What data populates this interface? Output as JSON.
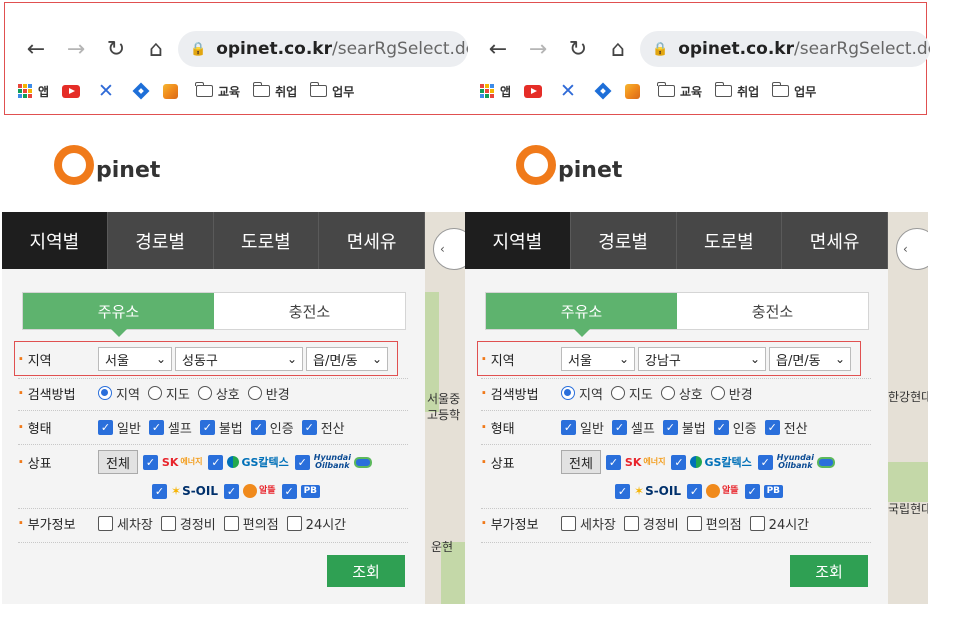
{
  "browser": {
    "url_host": "opinet.co.kr",
    "url_path": "/searRgSelect.do",
    "bookmarks": [
      {
        "label": "앱",
        "icon": "apps-grid-icon"
      },
      {
        "label": "",
        "icon": "youtube-icon"
      },
      {
        "label": "",
        "icon": "x-logo-icon"
      },
      {
        "label": "",
        "icon": "diamond-icon"
      },
      {
        "label": "",
        "icon": "cube-icon"
      },
      {
        "label": "교육",
        "icon": "folder-icon"
      },
      {
        "label": "취업",
        "icon": "folder-icon"
      },
      {
        "label": "업무",
        "icon": "folder-icon"
      }
    ]
  },
  "logo": {
    "letter": "O",
    "rest": "pinet"
  },
  "tabs": [
    "지역별",
    "경로별",
    "도로별",
    "면세유"
  ],
  "subtabs": [
    "주유소",
    "충전소"
  ],
  "labels": {
    "region": "지역",
    "search_method": "검색방법",
    "type": "형태",
    "brand": "상표",
    "extra": "부가정보"
  },
  "search_methods": [
    "지역",
    "지도",
    "상호",
    "반경"
  ],
  "types": [
    "일반",
    "셀프",
    "불법",
    "인증",
    "전산"
  ],
  "brands": {
    "all": "전체",
    "sk": "SK",
    "sk_sub": "에너지",
    "gs": "GS칼텍스",
    "hyundai_1": "Hyundai",
    "hyundai_2": "Oilbank",
    "soil": "S-OIL",
    "alddeul": "알뜰",
    "pb": "PB"
  },
  "extras": [
    "세차장",
    "경정비",
    "편의점",
    "24시간"
  ],
  "search_button": "조회",
  "panels": {
    "left": {
      "city": "서울",
      "district": "성동구",
      "town": "읍/면/동"
    },
    "right": {
      "city": "서울",
      "district": "강남구",
      "town": "읍/면/동"
    }
  },
  "map": {
    "left_labels": [
      "서울중",
      "고등학",
      "운현"
    ],
    "right_labels": [
      "한강현대",
      "국립현대"
    ]
  }
}
